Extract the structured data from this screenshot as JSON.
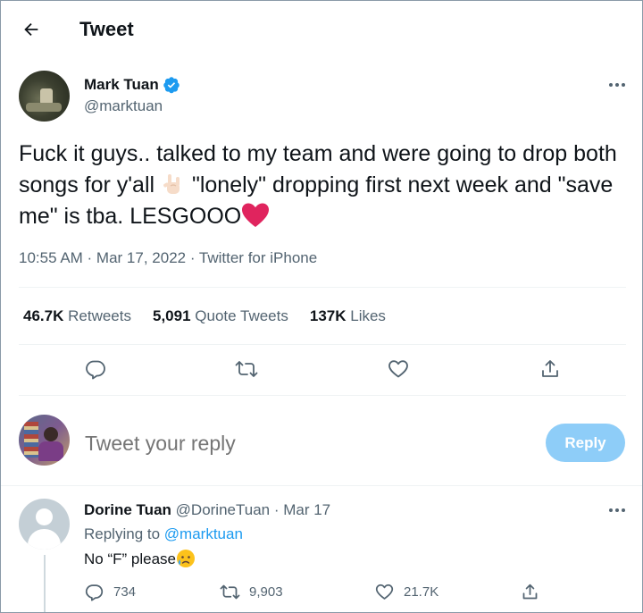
{
  "header": {
    "title": "Tweet"
  },
  "tweet": {
    "author_name": "Mark Tuan",
    "author_handle": "@marktuan",
    "text_part1": "Fuck it guys.. talked to my team and were going to drop both songs for y'all ",
    "text_part2": " \"lonely\" dropping first next week and \"save me\" is tba. LESGOOO",
    "meta": "10:55 AM · Mar 17, 2022 · Twitter for iPhone",
    "stats": {
      "retweets_count": "46.7K",
      "retweets_label": "Retweets",
      "quotes_count": "5,091",
      "quotes_label": "Quote Tweets",
      "likes_count": "137K",
      "likes_label": "Likes"
    }
  },
  "composer": {
    "placeholder": "Tweet your reply",
    "button_label": "Reply"
  },
  "reply": {
    "author_name": "Dorine Tuan",
    "author_handle": "@DorineTuan",
    "date": "· Mar 17",
    "replying_label": "Replying to ",
    "replying_handle": "@marktuan",
    "text": "No “F” please",
    "reply_count": "734",
    "retweet_count": "9,903",
    "like_count": "21.7K"
  },
  "colors": {
    "accent": "#1d9bf0",
    "reply_button": "#8ecdf8",
    "secondary_text": "#536471",
    "heart_emoji": "#e0245e"
  },
  "icons": {
    "back": "arrow-left-icon",
    "verified": "verified-badge-icon",
    "more": "more-horizontal-icon",
    "reply": "reply-icon",
    "retweet": "retweet-icon",
    "like": "heart-icon",
    "share": "share-icon"
  }
}
